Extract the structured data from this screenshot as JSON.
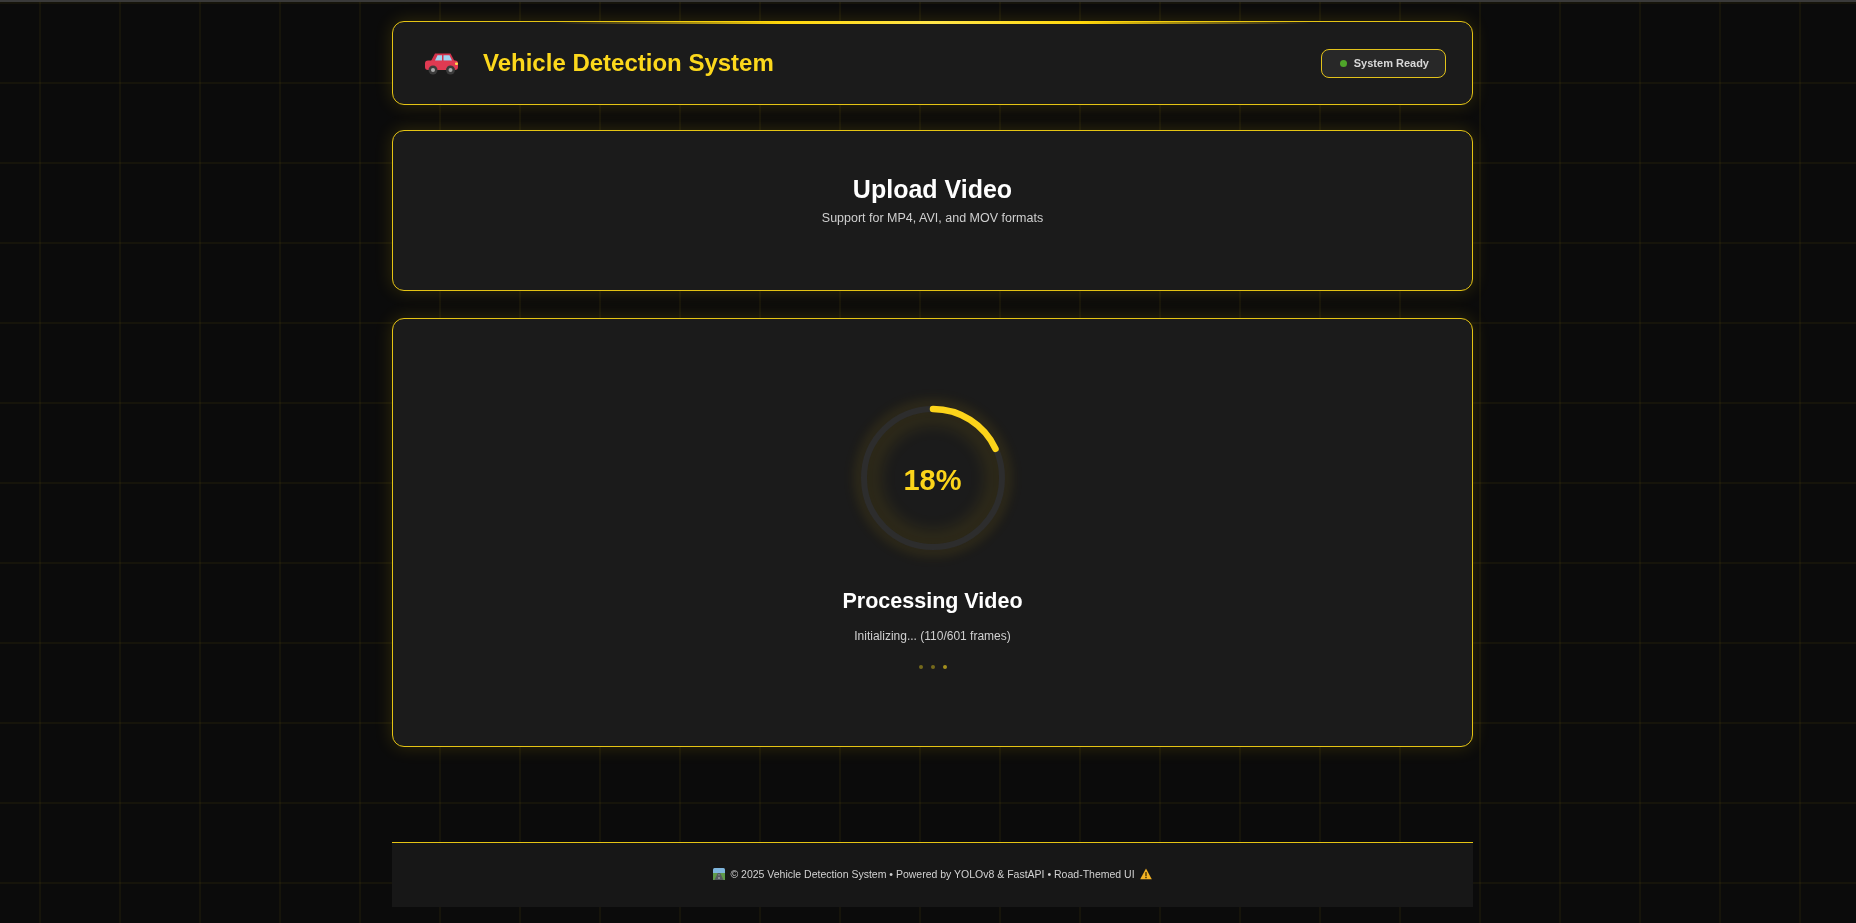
{
  "header": {
    "title": "Vehicle Detection System",
    "status": {
      "label": "System Ready",
      "ready": true
    }
  },
  "upload": {
    "title": "Upload Video",
    "subtitle": "Support for MP4, AVI, and MOV formats"
  },
  "processing": {
    "level": 0.18,
    "percent": "18%",
    "title": "Processing Video",
    "detail": "Initializing... (110/601 frames)"
  },
  "footer": {
    "text": "© 2025 Vehicle Detection System • Powered by YOLOv8 & FastAPI • Road-Themed UI"
  }
}
